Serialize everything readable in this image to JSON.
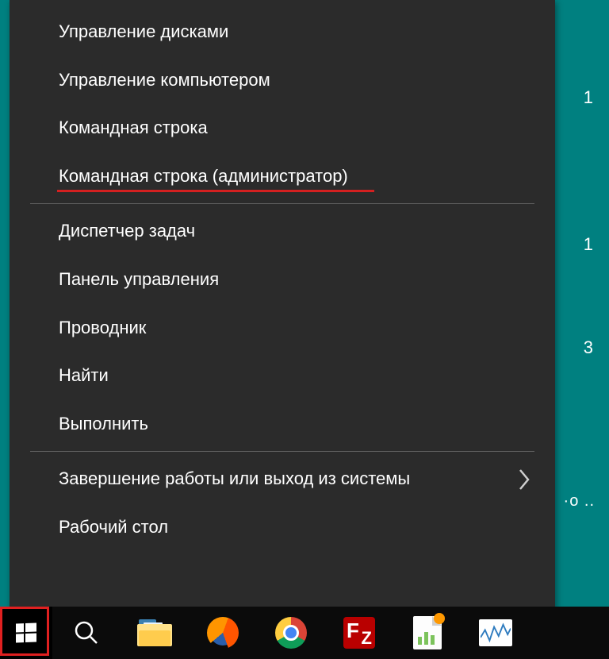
{
  "desktop_fragments": {
    "a": "1",
    "b": "1",
    "c": "3",
    "d": "·o\n.."
  },
  "menu": {
    "groups": [
      [
        {
          "label": "Управление дисками",
          "submenu": false
        },
        {
          "label": "Управление компьютером",
          "submenu": false
        },
        {
          "label": "Командная строка",
          "submenu": false
        },
        {
          "label": "Командная строка (администратор)",
          "submenu": false,
          "underline": true
        }
      ],
      [
        {
          "label": "Диспетчер задач",
          "submenu": false
        },
        {
          "label": "Панель управления",
          "submenu": false
        },
        {
          "label": "Проводник",
          "submenu": false
        },
        {
          "label": "Найти",
          "submenu": false
        },
        {
          "label": "Выполнить",
          "submenu": false
        }
      ],
      [
        {
          "label": "Завершение работы или выход из системы",
          "submenu": true
        },
        {
          "label": "Рабочий стол",
          "submenu": false
        }
      ]
    ]
  },
  "taskbar": {
    "start_highlighted": true,
    "icons": [
      "search",
      "explorer",
      "firefox",
      "chrome",
      "filezilla",
      "document-chart",
      "performance-monitor"
    ]
  }
}
